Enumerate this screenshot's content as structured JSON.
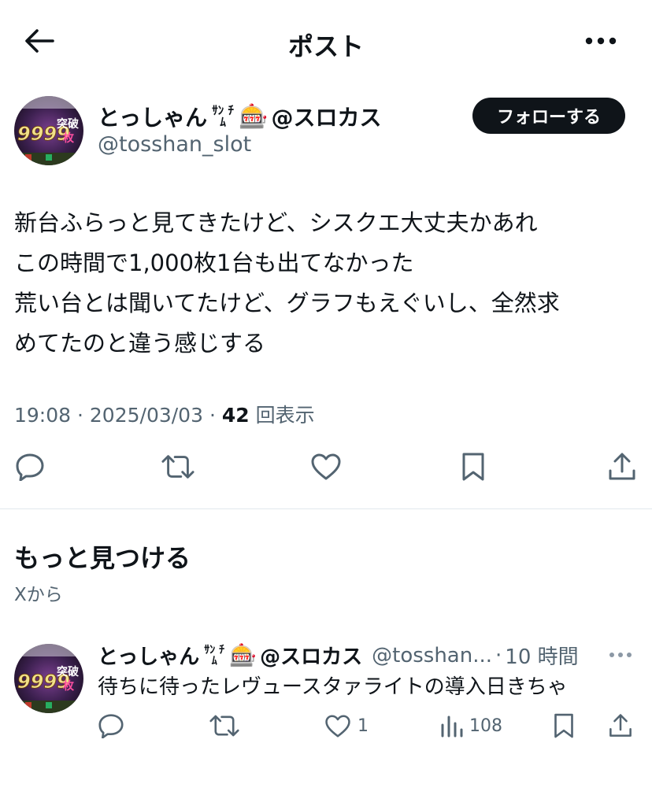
{
  "header": {
    "title": "ポスト",
    "back_icon": "arrow-left-icon",
    "more_icon": "more-horizontal-icon"
  },
  "post": {
    "display_name": "とっしゃん",
    "name_badge": "ｻﾝ ﾁﾑ",
    "name_emoji": "🎰",
    "name_suffix": "@スロカス",
    "handle": "@tosshan_slot",
    "follow_label": "フォローする",
    "text_lines": [
      "新台ふらっと見てきたけど、シスクエ大丈夫かあれ",
      "この時間で1,000枚1台も出てなかった",
      "荒い台とは聞いてたけど、グラフもえぐいし、全然求",
      "めてたのと違う感じする"
    ],
    "time": "19:08",
    "date": "2025/03/03",
    "sep": "·",
    "views_count": "42",
    "views_label": "回表示",
    "actions": [
      "reply-icon",
      "repost-icon",
      "like-icon",
      "bookmark-icon",
      "share-icon"
    ]
  },
  "discover": {
    "title": "もっと見つける",
    "subtitle": "Xから"
  },
  "related": {
    "display_name": "とっしゃん",
    "name_badge": "ｻﾝ ﾁﾑ",
    "name_emoji": "🎰",
    "name_suffix": "@スロカス",
    "handle": "@tosshan...",
    "sep": "·",
    "time_ago": "10 時間",
    "text": "待ちに待ったレヴュースタァライトの導入日きちゃ",
    "likes": "1",
    "views": "108"
  },
  "avatar_text": {
    "number": "9999",
    "kanji": "突破",
    "small": "枚"
  },
  "colors": {
    "text": "#0f1419",
    "muted": "#536471",
    "follow_bg": "#0f1419",
    "divider": "#e1e8ed"
  }
}
